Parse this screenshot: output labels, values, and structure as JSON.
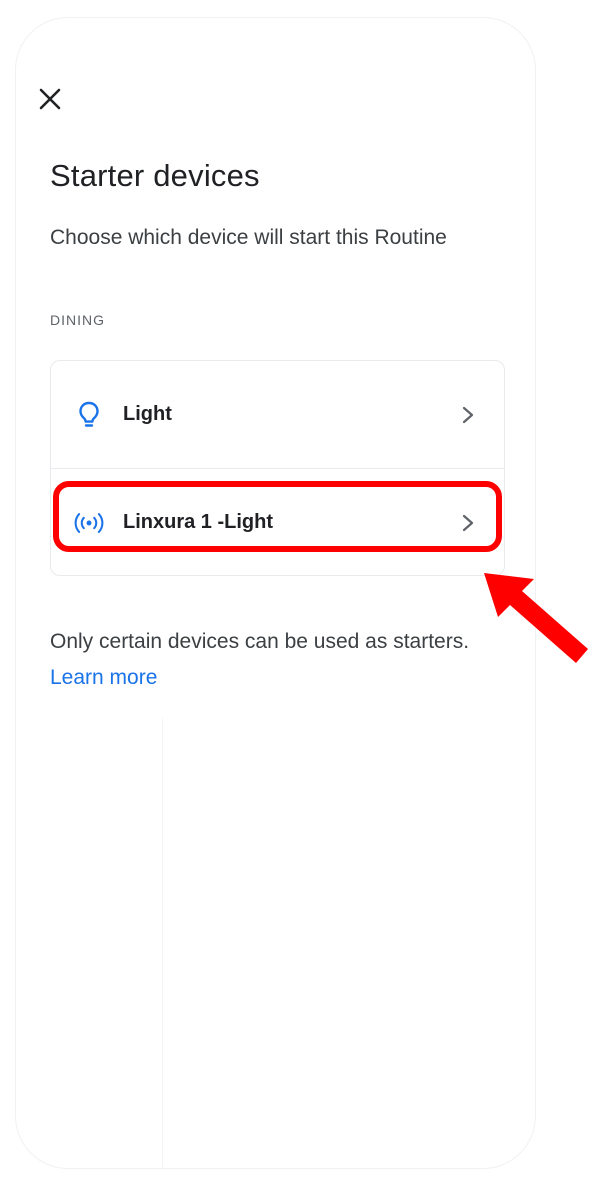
{
  "header": {
    "close_icon": "close-icon",
    "title": "Starter devices",
    "subtitle": "Choose which device will start this Routine"
  },
  "section": {
    "label": "DINING"
  },
  "devices": [
    {
      "label": "Light",
      "icon": "lightbulb-icon"
    },
    {
      "label": "Linxura 1 -Light",
      "icon": "wireless-signal-icon"
    }
  ],
  "footer": {
    "note": "Only certain devices can be used as starters.",
    "link": "Learn more"
  },
  "colors": {
    "accent_blue": "#1a73e8",
    "annotation_red": "#ff0000",
    "text_primary": "#202124",
    "text_secondary": "#5f6368"
  }
}
